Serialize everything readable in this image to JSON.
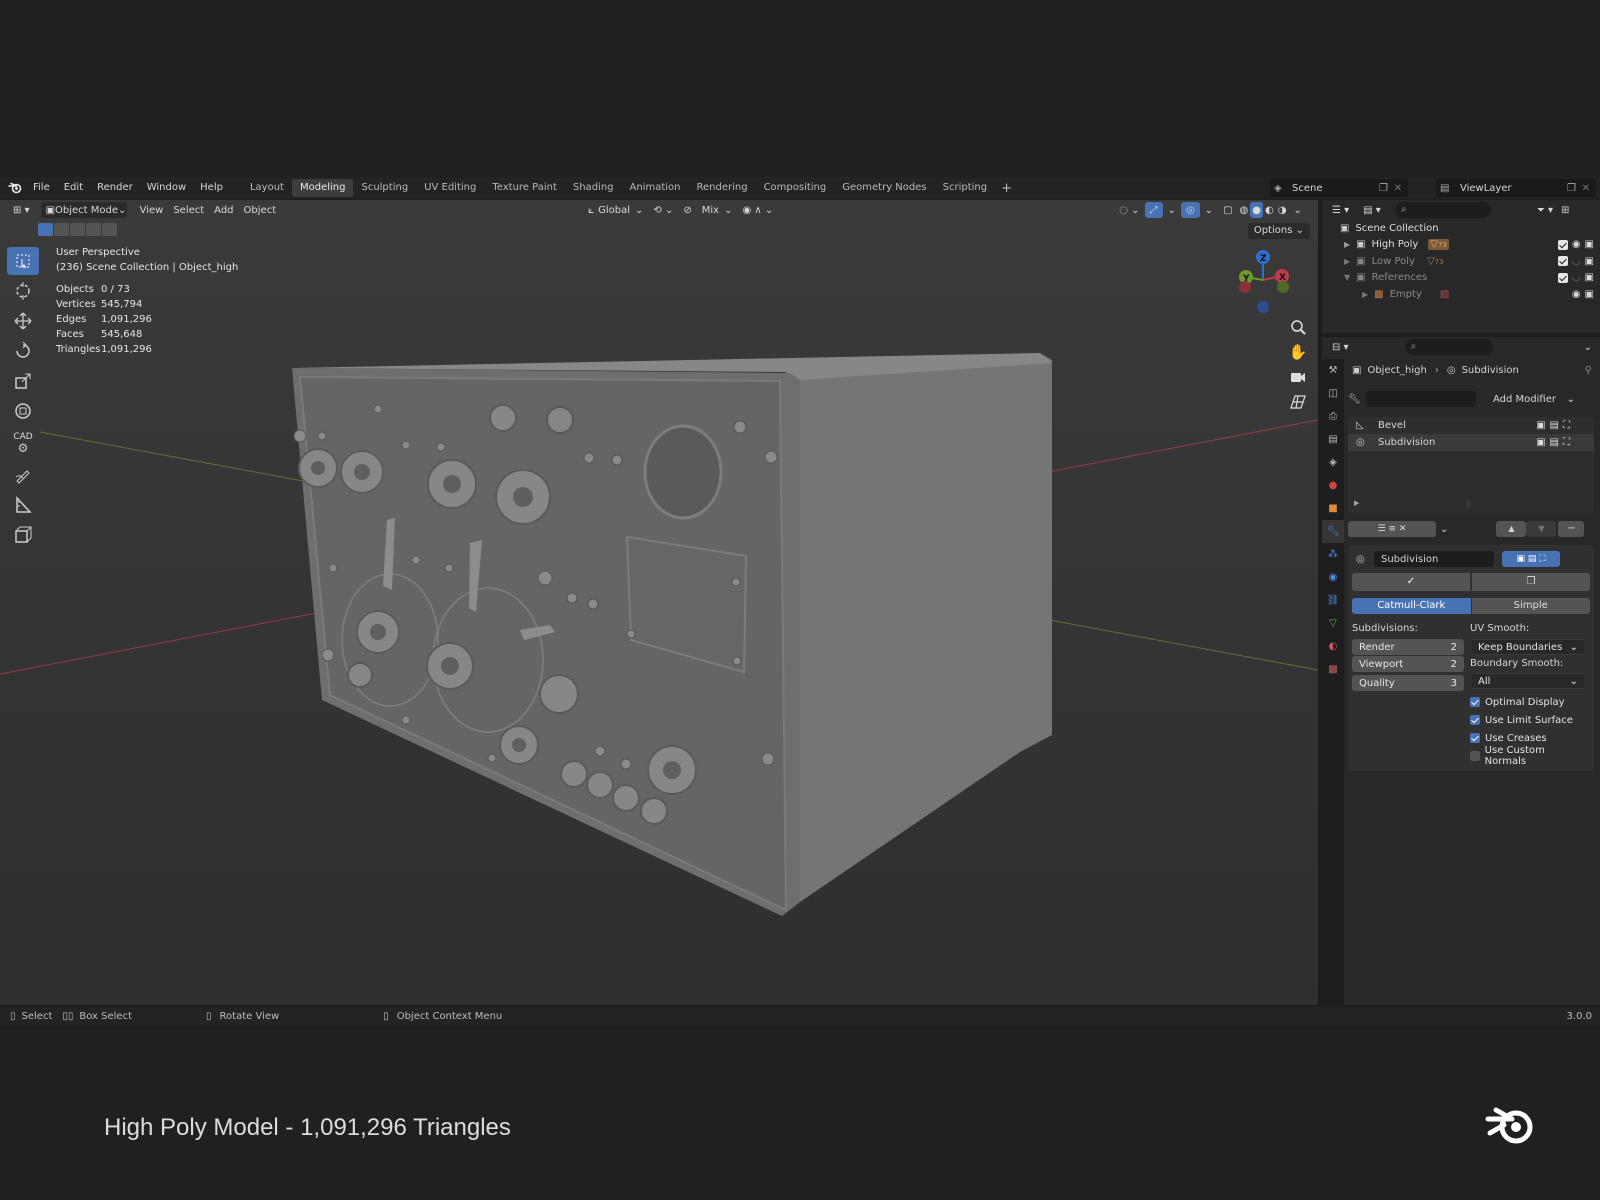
{
  "topbar": {
    "menus": [
      "File",
      "Edit",
      "Render",
      "Window",
      "Help"
    ],
    "workspaces": [
      "Layout",
      "Modeling",
      "Sculpting",
      "UV Editing",
      "Texture Paint",
      "Shading",
      "Animation",
      "Rendering",
      "Compositing",
      "Geometry Nodes",
      "Scripting"
    ],
    "active_workspace": "Modeling",
    "scene": "Scene",
    "view_layer": "ViewLayer"
  },
  "viewport": {
    "mode": "Object Mode",
    "menus": [
      "View",
      "Select",
      "Add",
      "Object"
    ],
    "orientation": "Global",
    "snap_mode": "Mix",
    "options_label": "Options",
    "perspective_label": "User Perspective",
    "collection_label": "(236) Scene Collection | Object_high",
    "stats": [
      {
        "label": "Objects",
        "value": "0 / 73"
      },
      {
        "label": "Vertices",
        "value": "545,794"
      },
      {
        "label": "Edges",
        "value": "1,091,296"
      },
      {
        "label": "Faces",
        "value": "545,648"
      },
      {
        "label": "Triangles",
        "value": "1,091,296"
      }
    ],
    "gizmo": {
      "z": "Z",
      "y": "Y",
      "x": "X"
    },
    "cad_label": "CAD"
  },
  "outliner": {
    "root": "Scene Collection",
    "items": [
      {
        "label": "High Poly",
        "badge": "73",
        "dim": false
      },
      {
        "label": "Low Poly",
        "badge": "73",
        "dim": true
      },
      {
        "label": "References",
        "badge": "",
        "dim": true
      },
      {
        "label": "Empty",
        "badge": "",
        "dim": true
      }
    ]
  },
  "properties": {
    "breadcrumb_object": "Object_high",
    "breadcrumb_modifier": "Subdivision",
    "add_modifier_label": "Add Modifier",
    "modifier_stack": [
      "Bevel",
      "Subdivision"
    ],
    "modifier_name": "Subdivision",
    "type_options": [
      "Catmull-Clark",
      "Simple"
    ],
    "subdivisions_label": "Subdivisions:",
    "render_label": "Render",
    "render_value": "2",
    "viewport_label": "Viewport",
    "viewport_value": "2",
    "quality_label": "Quality",
    "quality_value": "3",
    "uv_smooth_label": "UV Smooth:",
    "uv_smooth_value": "Keep Boundaries",
    "boundary_smooth_label": "Boundary Smooth:",
    "boundary_smooth_value": "All",
    "checkboxes": [
      {
        "label": "Optimal Display",
        "checked": true
      },
      {
        "label": "Use Limit Surface",
        "checked": true
      },
      {
        "label": "Use Creases",
        "checked": true
      },
      {
        "label": "Use Custom Normals",
        "checked": false
      }
    ]
  },
  "statusbar": {
    "select": "Select",
    "box_select": "Box Select",
    "rotate_view": "Rotate View",
    "context_menu": "Object Context Menu",
    "version": "3.0.0"
  },
  "caption": "High Poly Model - 1,091,296 Triangles",
  "colors": {
    "accent": "#4772b3",
    "viewport_bg": "#393939",
    "panel_bg": "#282828",
    "axis_x": "#c13a4a",
    "axis_y": "#6e9a2b",
    "axis_z": "#2f6fce"
  }
}
